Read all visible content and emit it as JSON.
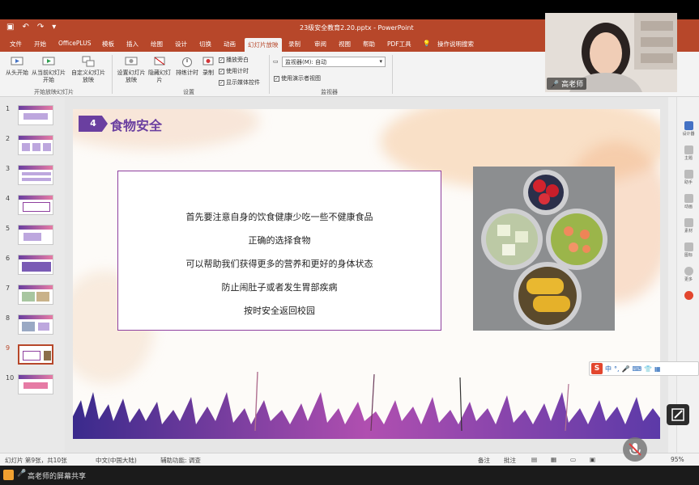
{
  "titlebar": {
    "title": "23级安全教育2.20.pptx - PowerPoint"
  },
  "tabs": [
    "文件",
    "开始",
    "OfficePLUS",
    "模板",
    "插入",
    "绘图",
    "设计",
    "切换",
    "动画",
    "幻灯片放映",
    "录制",
    "审阅",
    "视图",
    "帮助",
    "PDF工具",
    "操作说明搜索"
  ],
  "ribbon": {
    "from_start": "从头开始",
    "from_current": "从当前幻灯片开始",
    "custom_show": "自定义幻灯片放映",
    "group_start": "开始放映幻灯片",
    "setup_show": "设置幻灯片放映",
    "hide_slide": "隐藏幻灯片",
    "rehearse": "排练计时",
    "record": "录制",
    "group_setup": "设置",
    "play_narration": "播放旁白",
    "use_timings": "使用计时",
    "show_media": "显示媒体控件",
    "monitor_label": "监视器(M):",
    "monitor_value": "自动",
    "presenter_view": "使用演示者视图",
    "group_monitor": "监视器"
  },
  "thumbnails": [
    "1",
    "2",
    "3",
    "4",
    "5",
    "6",
    "7",
    "8",
    "9",
    "10"
  ],
  "slide": {
    "number": "4",
    "title": "食物安全",
    "lines": [
      "首先要注意自身的饮食健康少吃一些不健康食品",
      "正确的选择食物",
      "可以帮助我们获得更多的营养和更好的身体状态",
      "防止闹肚子或者发生胃部疾病",
      "按时安全返回校园"
    ]
  },
  "rightpane": [
    "设计器",
    "主题",
    "助手",
    "动画",
    "素材",
    "图标",
    "更多"
  ],
  "ime": "中",
  "status": {
    "slide_count": "幻灯片 第9张，共10张",
    "language": "中文(中国大陆)",
    "accessibility": "辅助功能: 调查",
    "notes": "备注",
    "comments": "批注",
    "zoom": "95%"
  },
  "webcam": {
    "name": "高老师"
  },
  "bottombar": {
    "label": "高老师的屏幕共享"
  },
  "colors": {
    "accent": "#b7472a",
    "slide_purple": "#6a3fa0"
  }
}
